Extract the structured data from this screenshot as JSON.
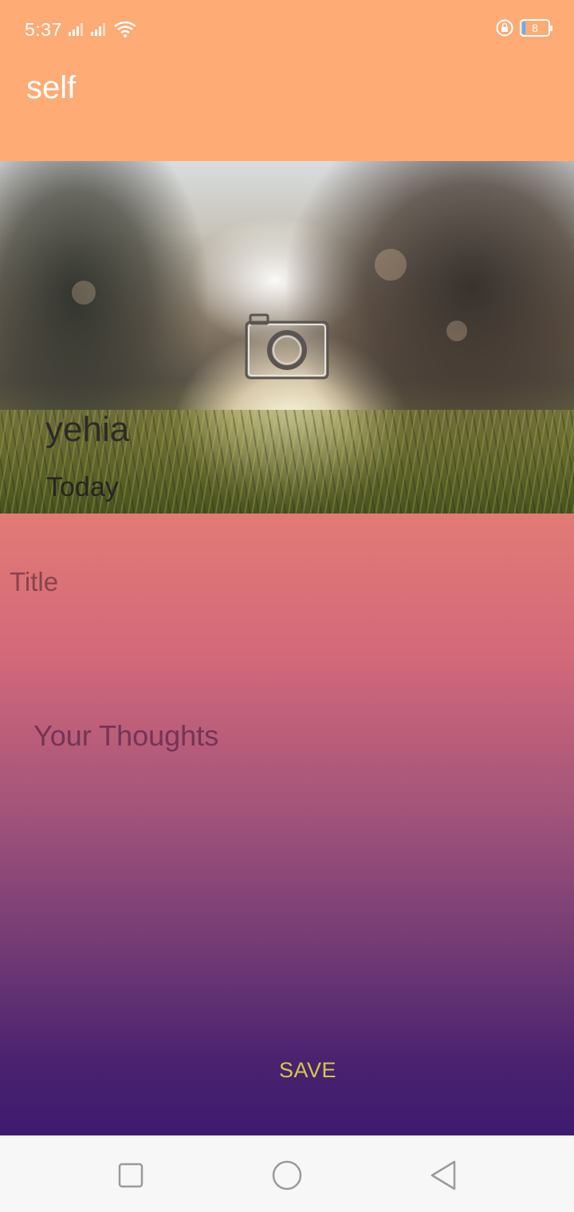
{
  "status_bar": {
    "time": "5:37",
    "battery_level": "8",
    "icons": [
      "signal-icon",
      "signal-icon",
      "wifi-icon",
      "lock-icon",
      "battery-icon"
    ]
  },
  "app_bar": {
    "title": "self",
    "background_color": "#ffab76"
  },
  "hero": {
    "name": "yehia",
    "date": "Today",
    "camera_icon": "camera-icon"
  },
  "form": {
    "title_placeholder": "Title",
    "thoughts_placeholder": "Your Thoughts",
    "save_label": "SAVE",
    "save_color": "#d4c74a",
    "gradient_top": "#e27a75",
    "gradient_bottom": "#3e1a6f"
  },
  "nav_bar": {
    "buttons": [
      "recents-icon",
      "home-icon",
      "back-icon"
    ]
  }
}
